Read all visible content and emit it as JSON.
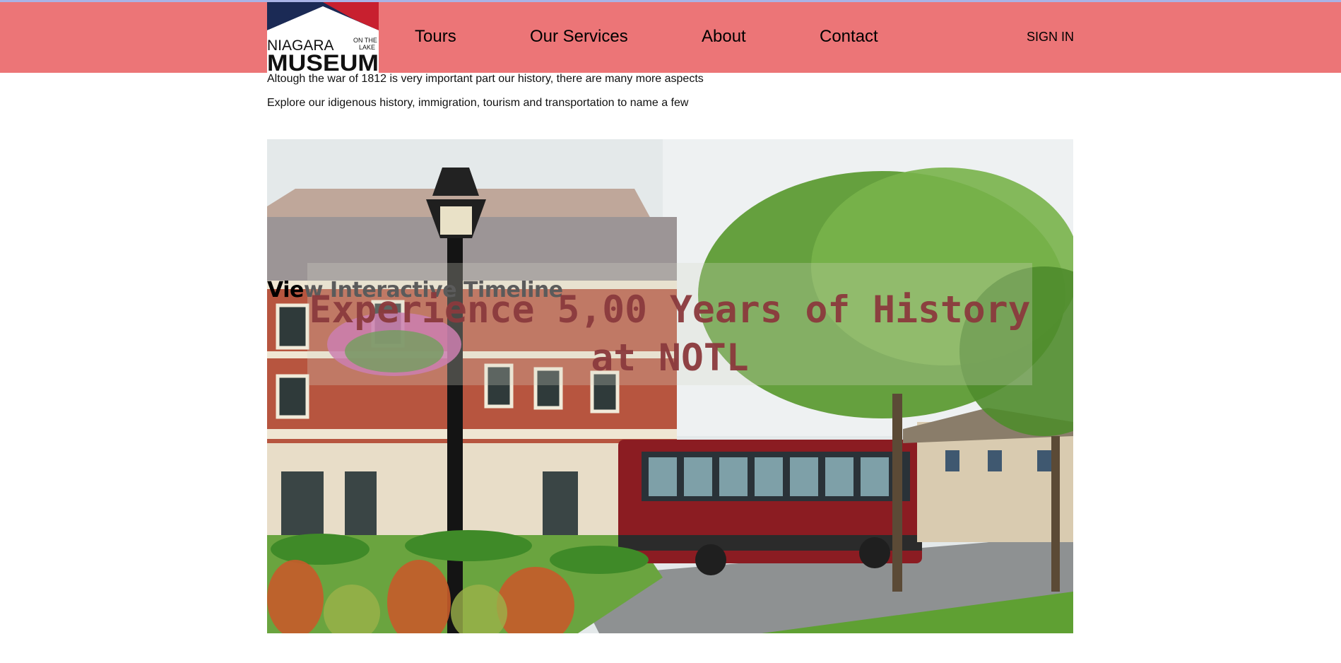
{
  "header": {
    "logo": {
      "line1": "NIAGARA",
      "line1_small_top": "ON THE",
      "line1_small_bottom": "LAKE",
      "line2": "MUSEUM"
    },
    "nav": [
      {
        "label": "Tours"
      },
      {
        "label": "Our Services"
      },
      {
        "label": "About"
      },
      {
        "label": "Contact"
      }
    ],
    "sign_in": "SIGN IN"
  },
  "intro": {
    "line1": "Altough the war of 1812 is very important part our history, there are many more aspects",
    "line2": "Explore our idigenous history, immigration, tourism and transportation to name a few"
  },
  "hero": {
    "timeline_link_start": "Vie",
    "timeline_link_rest": "w Interactive Timeline",
    "headline": "Experience 5,00 Years of History at NOTL"
  },
  "colors": {
    "navbar": "#ec7577",
    "top_strip": "#a9b3e6",
    "headline": "#8b3a3d",
    "logo_navy": "#1b2a55",
    "logo_red": "#c8202f"
  }
}
